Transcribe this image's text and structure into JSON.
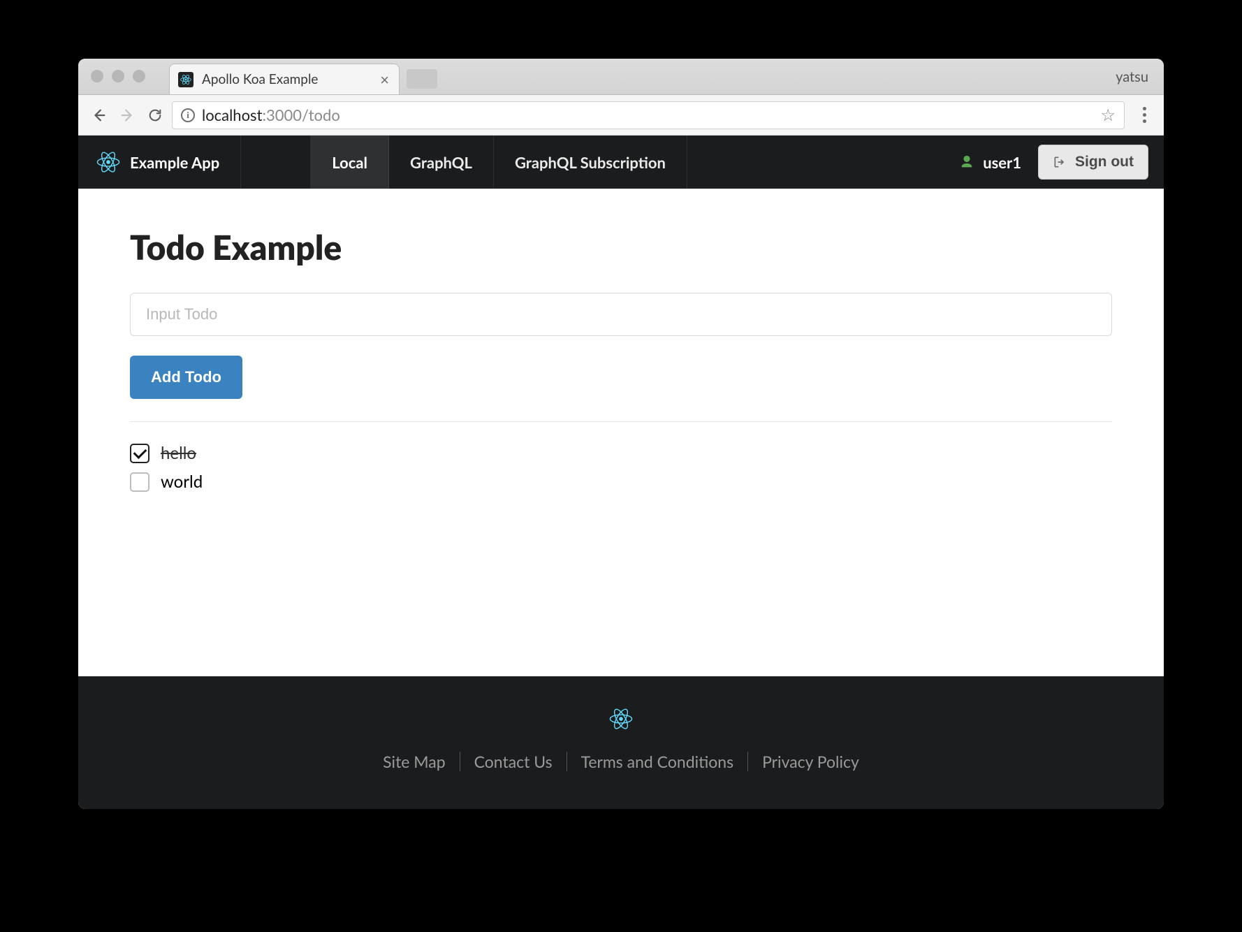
{
  "browser": {
    "tab_title": "Apollo Koa Example",
    "profile": "yatsu",
    "url_host": "localhost",
    "url_rest": ":3000/todo"
  },
  "nav": {
    "brand": "Example App",
    "items": [
      "Local",
      "GraphQL",
      "GraphQL Subscription"
    ],
    "active_index": 0,
    "user": "user1",
    "signout": "Sign out"
  },
  "main": {
    "title": "Todo Example",
    "input_placeholder": "Input Todo",
    "add_button": "Add Todo",
    "todos": [
      {
        "text": "hello",
        "done": true
      },
      {
        "text": "world",
        "done": false
      }
    ]
  },
  "footer": {
    "links": [
      "Site Map",
      "Contact Us",
      "Terms and Conditions",
      "Privacy Policy"
    ]
  },
  "colors": {
    "accent": "#3b83c0",
    "react": "#61dafb",
    "user_icon": "#5aa84f"
  }
}
